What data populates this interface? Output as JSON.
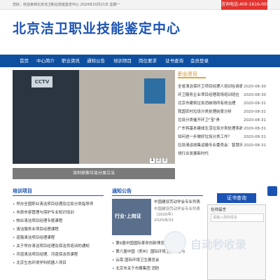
{
  "topbar": {
    "greeting": "您好，欢迎来到北京洁卫职业技能鉴定中心   2024年10月21日 星期一",
    "hotline": "咨询电话:400-1616-005"
  },
  "site": {
    "title": "北京洁卫职业技能鉴定中心"
  },
  "nav": {
    "items": [
      "首页",
      "中心简介",
      "职业资讯",
      "通知公告",
      "培训项目",
      "岗位要求",
      "证书查询",
      "会员登录"
    ]
  },
  "slider": {
    "logo_text": "CCTV",
    "pages": [
      "1",
      "2",
      "3"
    ],
    "active_page": 1,
    "caption": "深圳探索垃圾分类立法"
  },
  "news": {
    "tab": "职业资讯",
    "items": [
      {
        "title": "全省清洁保环卫项目经理人培训在商德举办",
        "date": "2020-08-30"
      },
      {
        "title": "环卫服务企业项目经理现场培训班在",
        "date": "2020-08-30"
      },
      {
        "title": "北京市建筑垃圾消纳场所有效治理",
        "date": "2020-08-31"
      },
      {
        "title": "我国农村垃圾分类处理前景分析",
        "date": "2020-08-31"
      },
      {
        "title": "垃圾分类催开环卫\"宝\"贵",
        "date": "2020-08-31"
      },
      {
        "title": "广东将基本建成生活垃圾分类处理系统",
        "date": "2020-08-31"
      },
      {
        "title": "如何进一步做好垃圾分类工作？",
        "date": "2020-08-31"
      },
      {
        "title": "垃圾清运收集运输专业委员会：智慧环卫引",
        "date": "2020-08-31"
      },
      {
        "title": "领行业发展新时代",
        "date": ""
      }
    ]
  },
  "col1": {
    "title": "培训项目",
    "items": [
      "举办全国职业清洁项目经理及垃圾分类指导师",
      "市政市容管理与保护专业知识培训",
      "物业清洁项目经理专题课程",
      "清洁服务业项目经理课程",
      "道路清洁项目经理课程",
      "关于举办清洁项目经理及保洁员培训的通知",
      "河道清洁项目经理、河道保洁员课程",
      "北京生态环境学科机器人项目"
    ]
  },
  "col2": {
    "title": "通知公告",
    "img_text": "行业·上岗证",
    "feature_title": "中国建设劳动学会专业列表",
    "feature_sub": "中国建设劳动学会专业列表（2020年）",
    "feature_date": "2020/8/31",
    "items": [
      "第6届中国国际革命创新博览会(CTRE)",
      "第六届中国（郑州）国际环境卫生设备与",
      "云南 国际环境卫生展览会",
      "北京市关于市属集团 消防"
    ]
  },
  "side": {
    "cert_button": "证书查询",
    "msg_title": "在线留言",
    "msg_placeholder": "请输入您的姓名"
  },
  "watermark": {
    "text": "自动秒收录"
  }
}
